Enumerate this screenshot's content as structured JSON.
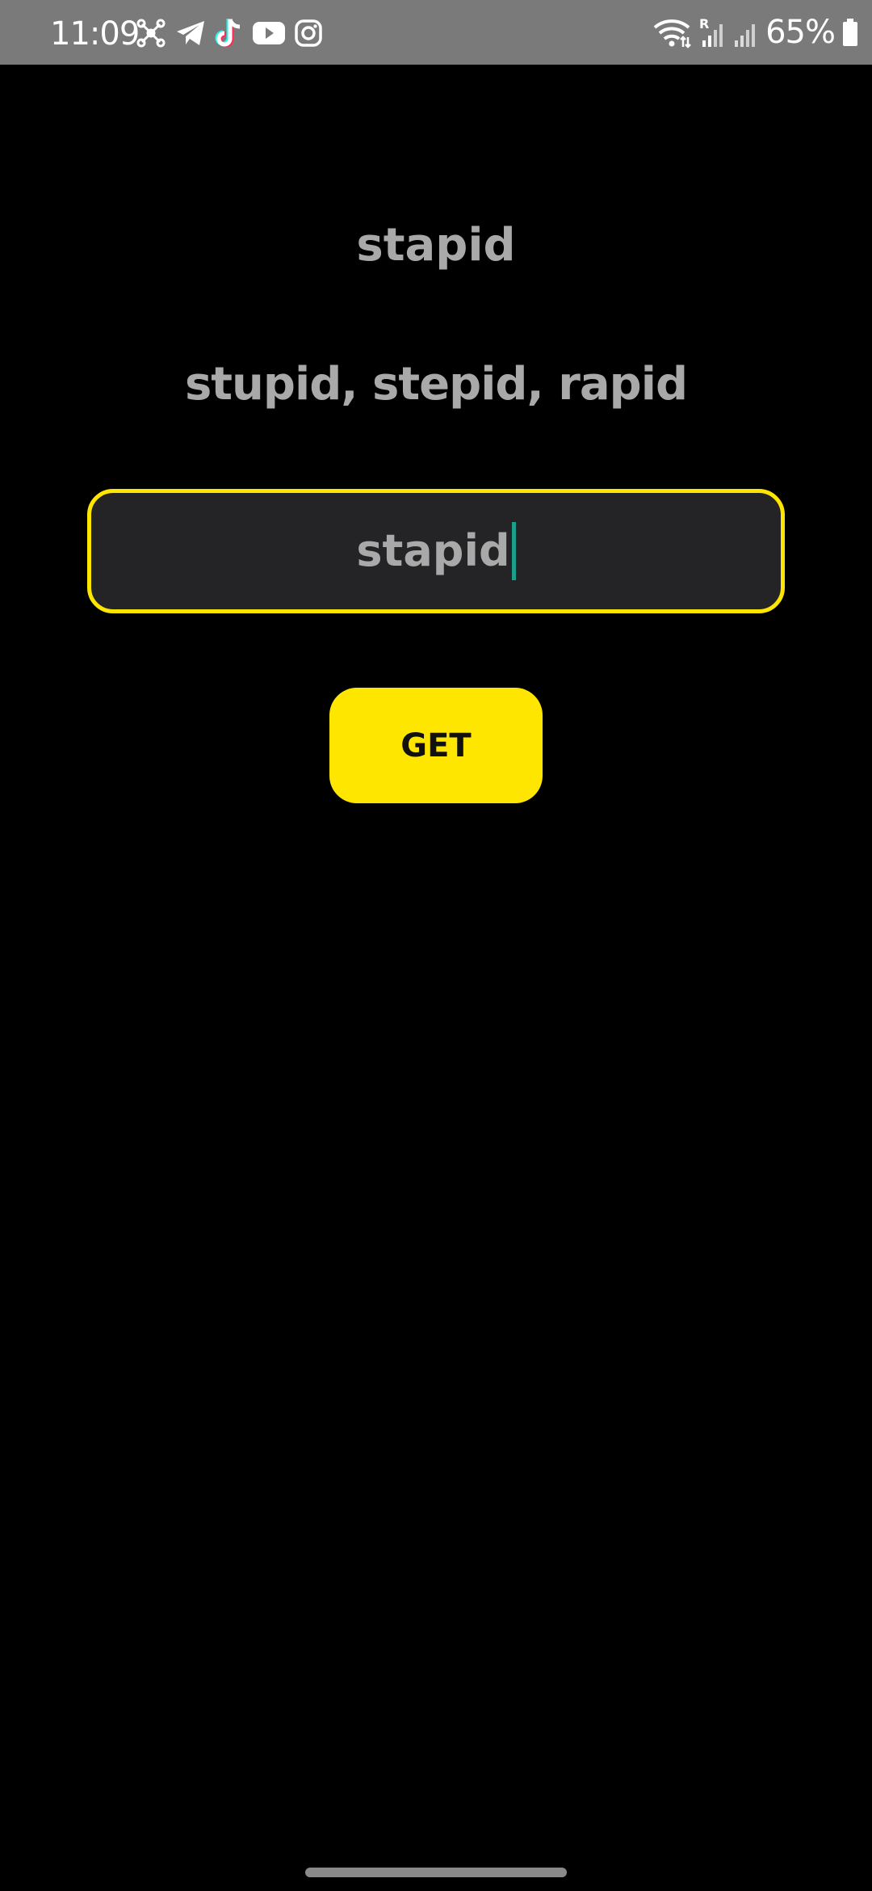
{
  "status_bar": {
    "time": "11:09",
    "notification_icons": [
      "network-hub-icon",
      "telegram-icon",
      "tiktok-icon",
      "youtube-icon",
      "instagram-icon"
    ],
    "system_icons": [
      "wifi-icon",
      "signal-roaming-icon",
      "signal-icon",
      "battery-icon"
    ],
    "roaming_label": "R",
    "battery_percent": "65%"
  },
  "main": {
    "word": "stapid",
    "suggestions": "stupid, stepid, rapid",
    "input": {
      "value": "stapid",
      "border_color": "#ffe600"
    },
    "get_button_label": "GET"
  },
  "colors": {
    "accent": "#ffe600",
    "background": "#000000",
    "text": "#a9a9a9",
    "input_bg": "#242426",
    "caret": "#1aa08a"
  }
}
